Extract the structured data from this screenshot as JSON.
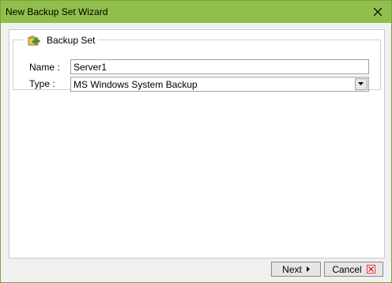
{
  "window": {
    "title": "New Backup Set Wizard"
  },
  "group": {
    "title": "Backup Set"
  },
  "form": {
    "name_label": "Name :",
    "name_value": "Server1",
    "type_label": "Type :",
    "type_value": "MS Windows System Backup"
  },
  "buttons": {
    "next_label": "Next",
    "cancel_label": "Cancel"
  },
  "colors": {
    "titlebar": "#8fbf4a",
    "cancel_icon": "#d9342b"
  },
  "icons": {
    "close": "close-icon",
    "legend": "backup-set-icon",
    "dropdown": "chevron-down-icon",
    "next": "arrow-right-icon",
    "cancel": "cancel-x-icon"
  }
}
